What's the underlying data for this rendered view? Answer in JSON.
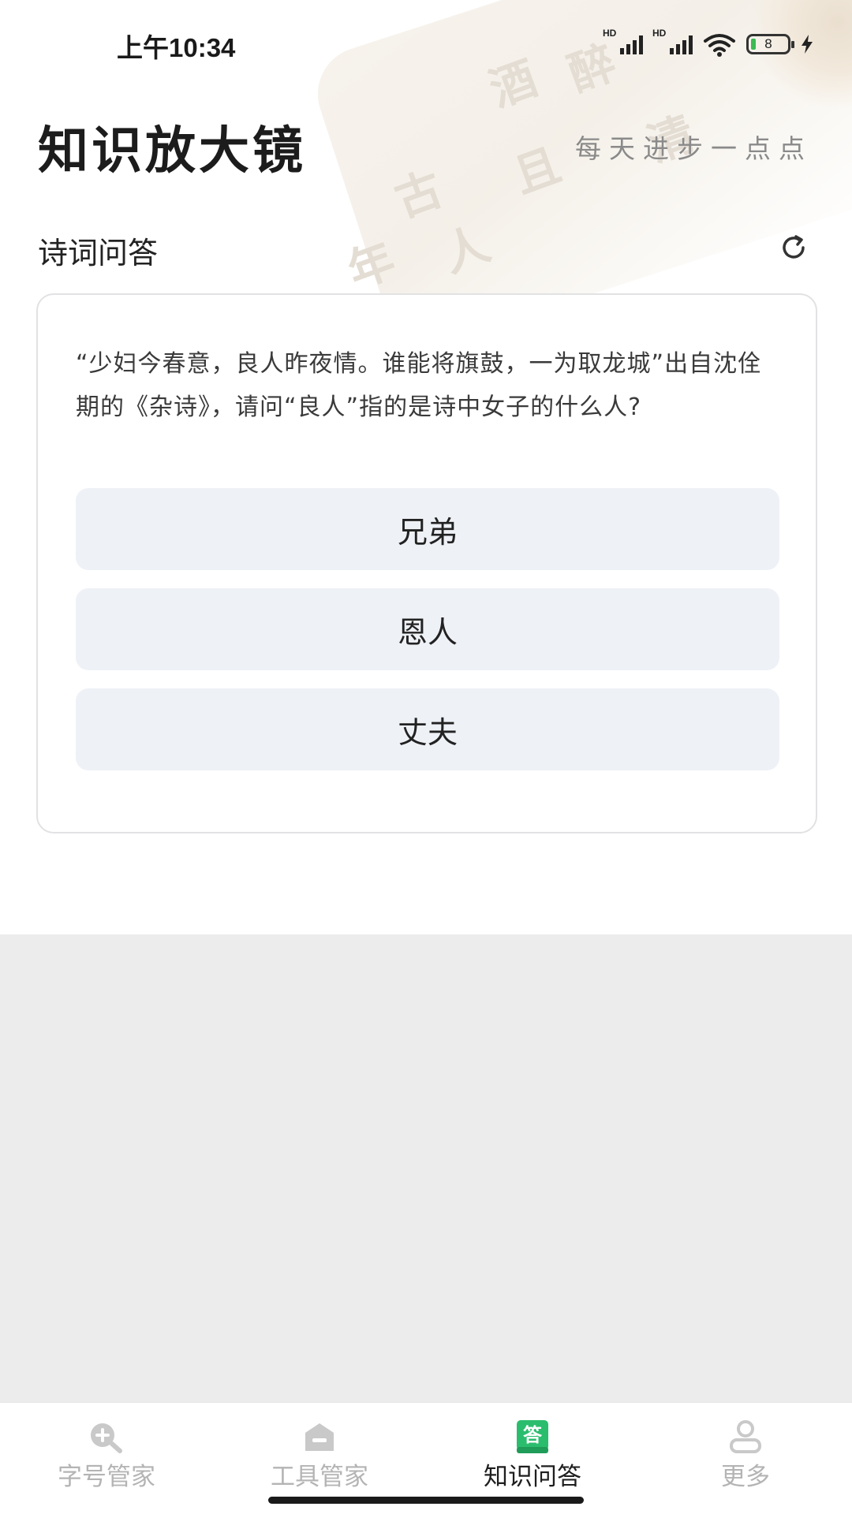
{
  "status_bar": {
    "time": "上午10:34",
    "signal_label": "HD",
    "battery_level": "8"
  },
  "header": {
    "title": "知识放大镜",
    "slogan": "每天进步一点点"
  },
  "section": {
    "title": "诗词问答",
    "refresh_icon": "refresh-icon"
  },
  "quiz": {
    "question": "“少妇今春意，良人昨夜情。谁能将旗鼓，一为取龙城”出自沈佺期的《杂诗》，请问“良人”指的是诗中女子的什么人?",
    "options": [
      "兄弟",
      "恩人",
      "丈夫"
    ]
  },
  "bottom_nav": {
    "active_index": 2,
    "accent_color": "#2bbd6e",
    "items": [
      {
        "label": "字号管家",
        "icon": "zoom-plus-icon"
      },
      {
        "label": "工具管家",
        "icon": "toolbox-icon"
      },
      {
        "label": "知识问答",
        "icon": "answer-book-icon"
      },
      {
        "label": "更多",
        "icon": "person-icon"
      }
    ]
  }
}
